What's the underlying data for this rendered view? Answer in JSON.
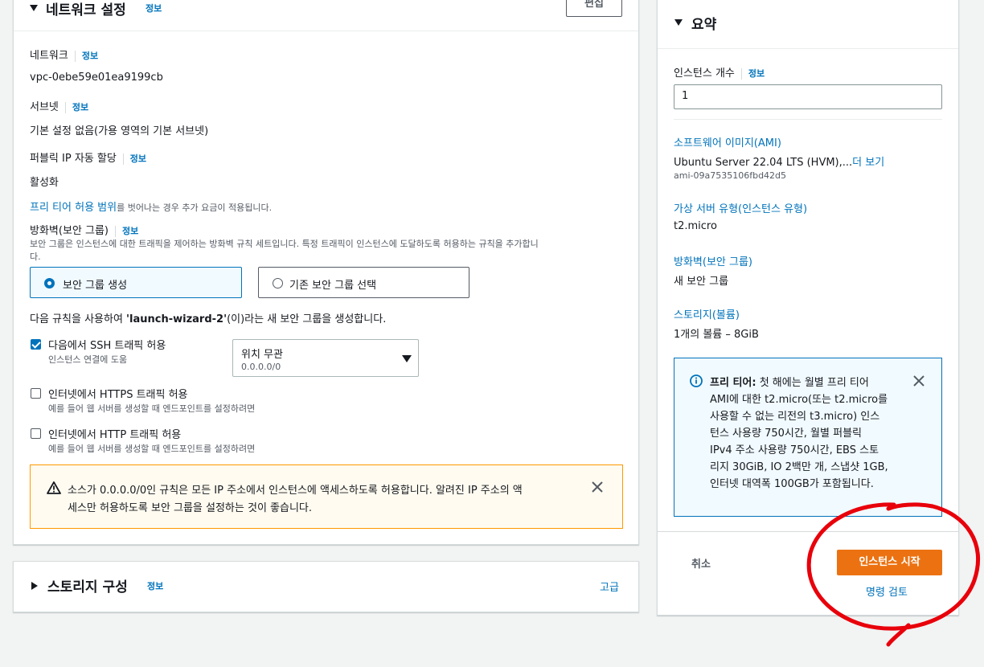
{
  "network": {
    "title": "네트워크 설정",
    "info": "정보",
    "edit_button": "편집",
    "network_label": "네트워크",
    "network_info": "정보",
    "network_value": "vpc-0ebe59e01ea9199cb",
    "subnet_label": "서브넷",
    "subnet_info": "정보",
    "subnet_value": "기본 설정 없음(가용 영역의 기본 서브넷)",
    "public_ip_label": "퍼블릭 IP 자동 할당",
    "public_ip_info": "정보",
    "public_ip_value": "활성화",
    "free_tier_link": "프리 티어 허용 범위",
    "free_tier_note": "를 벗어나는 경우 추가 요금이 적용됩니다.",
    "firewall_label": "방화벽(보안 그룹)",
    "firewall_info": "정보",
    "firewall_desc": "보안 그룹은 인스턴스에 대한 트래픽을 제어하는 방화벽 규칙 세트입니다. 특정 트래픽이 인스턴스에 도달하도록 허용하는 규칙을 추가합니",
    "firewall_desc_2": "다.",
    "sg_create": "보안 그룹 생성",
    "sg_existing": "기존 보안 그룹 선택",
    "rule_sentence_prefix": "다음 규칙을 사용하여 ",
    "rule_sentence_name": "'launch-wizard-2'",
    "rule_sentence_suffix": "(이)라는 새 보안 그룹을 생성합니다.",
    "ssh_label": "다음에서 SSH 트래픽 허용",
    "ssh_desc": "인스턴스 연결에 도움",
    "ssh_source_value": "위치 무관",
    "ssh_source_cidr": "0.0.0.0/0",
    "https_label": "인터넷에서 HTTPS 트래픽 허용",
    "https_desc": "예를 들어 웹 서버를 생성할 때 엔드포인트를 설정하려면",
    "http_label": "인터넷에서 HTTP 트래픽 허용",
    "http_desc": "예를 들어 웹 서버를 생성할 때 엔드포인트를 설정하려면",
    "warning_line1": "소스가 0.0.0.0/0인 규칙은 모든 IP 주소에서 인스턴스에 액세스하도록 허용합니다. 알려진 IP 주소의 액",
    "warning_line2": "세스만 허용하도록 보안 그룹을 설정하는 것이 좋습니다."
  },
  "storage": {
    "title": "스토리지 구성",
    "info": "정보",
    "advanced": "고급"
  },
  "summary": {
    "title": "요약",
    "instance_count_label": "인스턴스 개수",
    "instance_count_info": "정보",
    "instance_count_value": "1",
    "ami_label": "소프트웨어 이미지(AMI)",
    "ami_value": "Ubuntu Server 22.04 LTS (HVM),...",
    "ami_more": "더 보기",
    "ami_id": "ami-09a7535106fbd42d5",
    "instance_type_label": "가상 서버 유형(인스턴스 유형)",
    "instance_type_value": "t2.micro",
    "firewall_label": "방화벽(보안 그룹)",
    "firewall_value": "새 보안 그룹",
    "storage_label": "스토리지(볼륨)",
    "storage_value": "1개의 볼륨 – 8GiB",
    "free_tier_bold": "프리 티어:",
    "free_tier_lines": [
      " 첫 해에는 월별 프리 티어",
      "AMI에 대한 t2.micro(또는 t2.micro를",
      "사용할 수 없는 리전의 t3.micro) 인스",
      "턴스 사용량 750시간, 월별 퍼블릭",
      "IPv4 주소 사용량 750시간, EBS 스토",
      "리지 30GiB, IO 2백만 개, 스냅샷 1GB,",
      "인터넷 대역폭 100GB가 포함됩니다."
    ],
    "cancel": "취소",
    "launch": "인스턴스 시작",
    "review_commands": "명령 검토"
  },
  "colors": {
    "accent": "#0073bb",
    "primary": "#ec7211",
    "warning": "#ff9900",
    "annotation": "#e8000b"
  }
}
